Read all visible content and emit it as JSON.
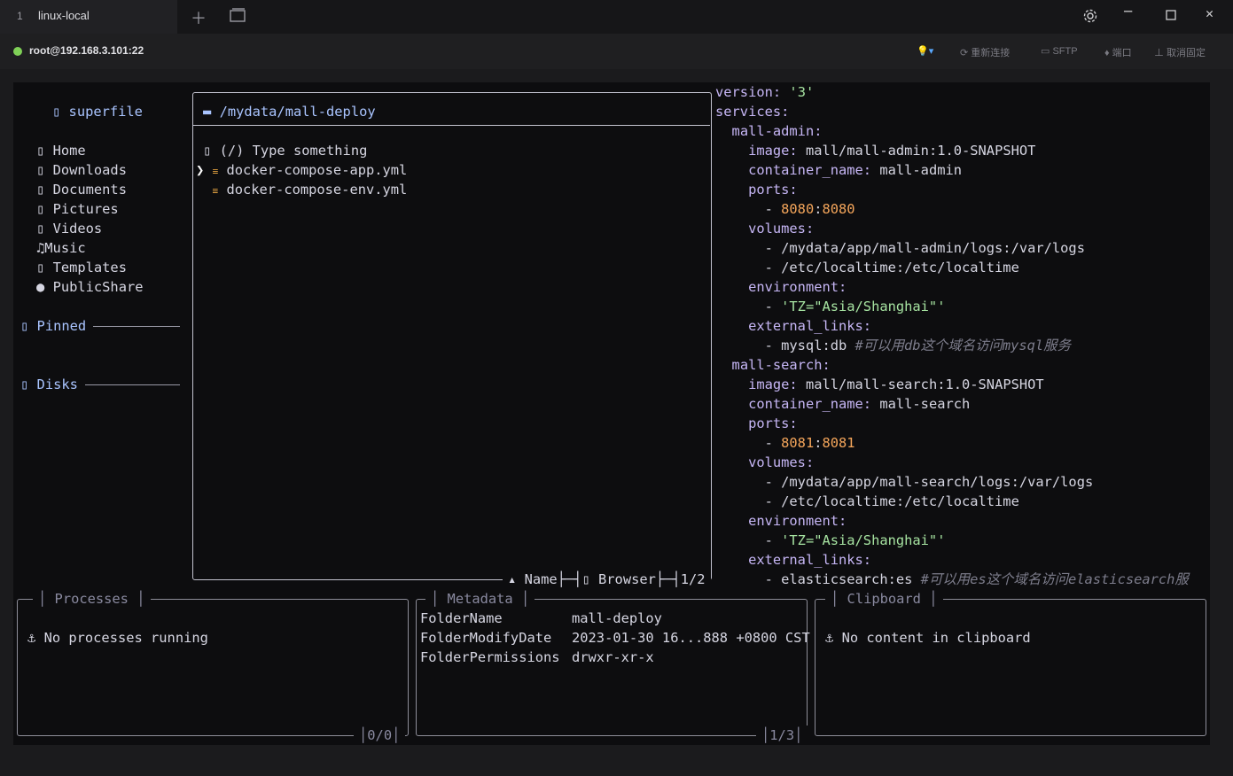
{
  "tab": {
    "number": "1",
    "name": "linux-local"
  },
  "status": {
    "connection": "root@192.168.3.101:22",
    "reconnect": "重新连接",
    "sftp": "SFTP",
    "port": "端口",
    "unpin": "取消固定"
  },
  "sidebar": {
    "title": "superfile",
    "items": [
      {
        "icon": "folder-icon",
        "label": "Home"
      },
      {
        "icon": "folder-icon",
        "label": "Downloads"
      },
      {
        "icon": "folder-icon",
        "label": "Documents"
      },
      {
        "icon": "folder-icon",
        "label": "Pictures"
      },
      {
        "icon": "folder-icon",
        "label": "Videos"
      },
      {
        "icon": "music-icon",
        "label": "Music"
      },
      {
        "icon": "folder-icon",
        "label": "Templates"
      },
      {
        "icon": "globe-icon",
        "label": "PublicShare"
      }
    ],
    "pinned": "Pinned",
    "disks": "Disks"
  },
  "file_panel": {
    "path": "/mydata/mall-deploy",
    "search_placeholder": "(/) Type something",
    "files": [
      "docker-compose-app.yml",
      "docker-compose-env.yml"
    ],
    "footer_sort": "Name",
    "footer_mode": "Browser",
    "footer_count": "1/2"
  },
  "preview_lines": [
    [
      [
        "k",
        "version:"
      ],
      [
        "t",
        " "
      ],
      [
        "g",
        "'3'"
      ]
    ],
    [
      [
        "k",
        "services:"
      ]
    ],
    [
      [
        "t",
        "  "
      ],
      [
        "k",
        "mall-admin:"
      ]
    ],
    [
      [
        "t",
        "    "
      ],
      [
        "k",
        "image:"
      ],
      [
        "t",
        " mall/mall-admin:1.0-SNAPSHOT"
      ]
    ],
    [
      [
        "t",
        "    "
      ],
      [
        "k",
        "container_name:"
      ],
      [
        "t",
        " mall-admin"
      ]
    ],
    [
      [
        "t",
        "    "
      ],
      [
        "k",
        "ports:"
      ]
    ],
    [
      [
        "t",
        "      - "
      ],
      [
        "o",
        "8080"
      ],
      [
        "t",
        ":"
      ],
      [
        "o",
        "8080"
      ]
    ],
    [
      [
        "t",
        "    "
      ],
      [
        "k",
        "volumes:"
      ]
    ],
    [
      [
        "t",
        "      - /mydata/app/mall-admin/logs:/var/logs"
      ]
    ],
    [
      [
        "t",
        "      - /etc/localtime:/etc/localtime"
      ]
    ],
    [
      [
        "t",
        "    "
      ],
      [
        "k",
        "environment:"
      ]
    ],
    [
      [
        "t",
        "      - "
      ],
      [
        "g",
        "'TZ=\"Asia/Shanghai\"'"
      ]
    ],
    [
      [
        "t",
        "    "
      ],
      [
        "k",
        "external_links:"
      ]
    ],
    [
      [
        "t",
        "      - mysql:db "
      ],
      [
        "c",
        "#可以用db这个域名访问mysql服务"
      ]
    ],
    [
      [
        "t",
        "  "
      ],
      [
        "k",
        "mall-search:"
      ]
    ],
    [
      [
        "t",
        "    "
      ],
      [
        "k",
        "image:"
      ],
      [
        "t",
        " mall/mall-search:1.0-SNAPSHOT"
      ]
    ],
    [
      [
        "t",
        "    "
      ],
      [
        "k",
        "container_name:"
      ],
      [
        "t",
        " mall-search"
      ]
    ],
    [
      [
        "t",
        "    "
      ],
      [
        "k",
        "ports:"
      ]
    ],
    [
      [
        "t",
        "      - "
      ],
      [
        "o",
        "8081"
      ],
      [
        "t",
        ":"
      ],
      [
        "o",
        "8081"
      ]
    ],
    [
      [
        "t",
        "    "
      ],
      [
        "k",
        "volumes:"
      ]
    ],
    [
      [
        "t",
        "      - /mydata/app/mall-search/logs:/var/logs"
      ]
    ],
    [
      [
        "t",
        "      - /etc/localtime:/etc/localtime"
      ]
    ],
    [
      [
        "t",
        "    "
      ],
      [
        "k",
        "environment:"
      ]
    ],
    [
      [
        "t",
        "      - "
      ],
      [
        "g",
        "'TZ=\"Asia/Shanghai\"'"
      ]
    ],
    [
      [
        "t",
        "    "
      ],
      [
        "k",
        "external_links:"
      ]
    ],
    [
      [
        "t",
        "      - elasticsearch:es "
      ],
      [
        "c",
        "#可以用es这个域名访问elasticsearch服"
      ]
    ]
  ],
  "processes": {
    "title": "Processes",
    "empty": "No processes running",
    "count": "0/0"
  },
  "metadata": {
    "title": "Metadata",
    "rows": [
      {
        "key": "FolderName",
        "value": "mall-deploy"
      },
      {
        "key": "FolderModifyDate",
        "value": "2023-01-30 16...888 +0800 CST"
      },
      {
        "key": "FolderPermissions",
        "value": "drwxr-xr-x"
      }
    ],
    "count": "1/3"
  },
  "clipboard": {
    "title": "Clipboard",
    "empty": "No content in clipboard"
  }
}
